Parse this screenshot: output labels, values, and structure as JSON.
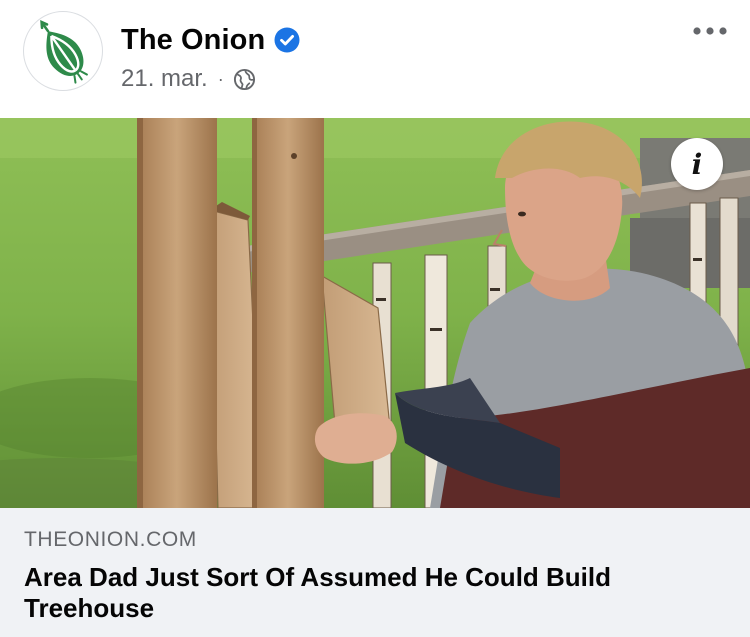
{
  "post": {
    "page_name": "The Onion",
    "verified_icon": "verified-badge-icon",
    "date": "21. mar.",
    "separator": "·",
    "audience_icon": "globe-icon",
    "more_icon": "more-options-icon",
    "avatar_logo": "onion-logo"
  },
  "media": {
    "info_label": "i",
    "info_icon": "info-icon",
    "image_subject": "photo-man-breaking-wooden-fence-board"
  },
  "link": {
    "domain": "THEONION.COM",
    "title": "Area Dad Just Sort Of Assumed He Could Build Treehouse"
  },
  "colors": {
    "brand_green": "#2e8a4a",
    "verified_blue": "#1b74e4",
    "muted_text": "#65676b",
    "card_background": "#f0f2f5"
  }
}
